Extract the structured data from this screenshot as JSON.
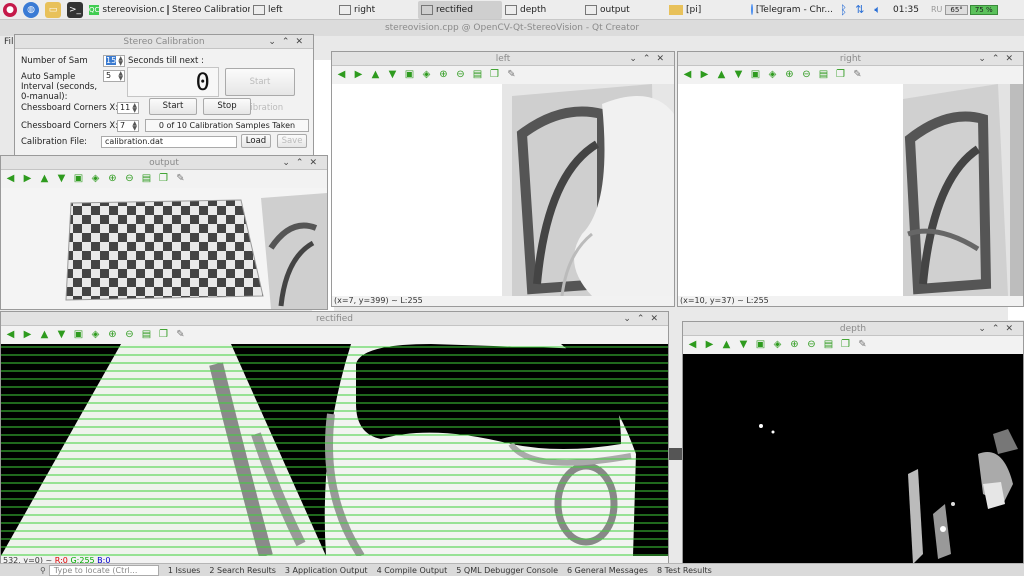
{
  "taskbar": {
    "items": [
      {
        "label": "stereovision.cp...",
        "active": false
      },
      {
        "label": "Stereo Calibration",
        "active": false
      },
      {
        "label": "left",
        "active": false
      },
      {
        "label": "right",
        "active": false
      },
      {
        "label": "rectified",
        "active": true
      },
      {
        "label": "depth",
        "active": false
      },
      {
        "label": "output",
        "active": false
      },
      {
        "label": "[pi]",
        "active": false
      },
      {
        "label": "[Telegram - Chr...",
        "active": false
      }
    ],
    "clock": "01:35",
    "cpu": "65°",
    "battery": "75 %",
    "lang": "RU"
  },
  "creator": {
    "title": "stereovision.cpp @ OpenCV-Qt-StereoVision - Qt Creator",
    "menu_first": "Fil"
  },
  "calibration": {
    "title": "Stereo Calibration",
    "number_of_samples_label": "Number of Sam",
    "number_of_samples_value": "15",
    "seconds_till_next_label": "Seconds till next :",
    "countdown": "0",
    "auto_interval_label": "Auto Sample Interval (seconds, 0-manual):",
    "auto_interval_value": "5",
    "start_calibration": "Start Calibration",
    "corners_x_label": "Chessboard Corners X:",
    "corners_x_value": "11",
    "start": "Start",
    "stop": "Stop",
    "corners_y_label": "Chessboard Corners X:",
    "corners_y_value": "7",
    "samples_status": "0 of 10 Calibration Samples Taken",
    "file_label": "Calibration File:",
    "file_value": "calibration.dat",
    "load": "Load",
    "save": "Save"
  },
  "windows": {
    "left": {
      "title": "left",
      "status": "(x=7, y=399) ~ L:255"
    },
    "right": {
      "title": "right",
      "status": "(x=10, y=37) ~ L:255"
    },
    "output": {
      "title": "output"
    },
    "rectified": {
      "title": "rectified",
      "status_prefix": "532, y=0) ~ ",
      "status_r": "R:0",
      "status_g": "G:255",
      "status_b": "B:0"
    },
    "depth": {
      "title": "depth"
    }
  },
  "outputbar": {
    "locator": "Type to locate (Ctrl...",
    "tabs": [
      "1 Issues",
      "2 Search Results",
      "3 Application Output",
      "4 Compile Output",
      "5 QML Debugger Console",
      "6 General Messages",
      "8 Test Results"
    ]
  },
  "colors": {
    "accent_green": "#2e9b1e",
    "rect_line": "#3fd13a"
  }
}
